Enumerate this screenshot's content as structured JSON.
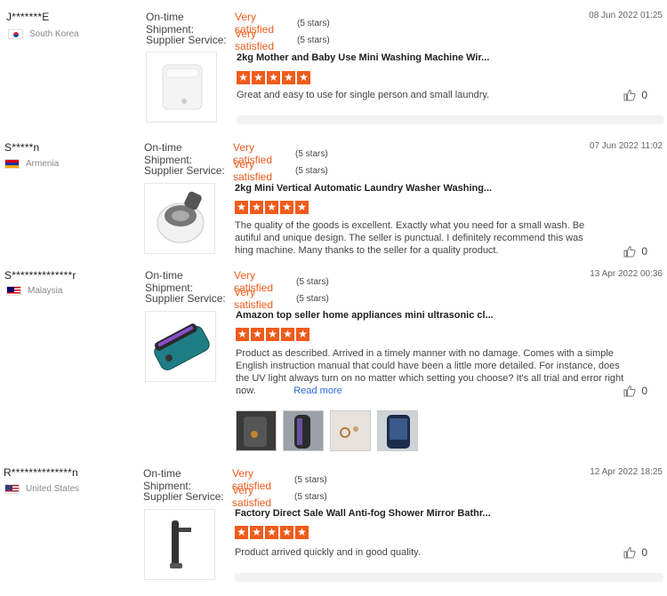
{
  "labels": {
    "ontime": "On-time Shipment:",
    "supplier": "Supplier Service:"
  },
  "colors": {
    "accent": "#f05b1b",
    "link": "#2a6ad8"
  },
  "reviews": [
    {
      "buyer": "J*******E",
      "country": "South Korea",
      "flag_icon": "south-korea-flag-icon",
      "date": "08 Jun 2022 01:25",
      "ontime_value": "Very satisfied",
      "ontime_stars": "(5 stars)",
      "supplier_value": "Very satisfied",
      "supplier_stars": "(5 stars)",
      "product_title": "2kg Mother and Baby Use Mini Washing Machine Wir...",
      "rating": 5,
      "text": "Great and easy to use for single person and small laundry.",
      "likes": "0"
    },
    {
      "buyer": "S*****n",
      "country": "Armenia",
      "flag_icon": "armenia-flag-icon",
      "date": "07 Jun 2022 11:02",
      "ontime_value": "Very satisfied",
      "ontime_stars": "(5 stars)",
      "supplier_value": "Very satisfied",
      "supplier_stars": "(5 stars)",
      "product_title": "2kg Mini Vertical Automatic Laundry Washer Washing...",
      "rating": 5,
      "text": "The quality of the goods is excellent.  Exactly what you need for a small wash.  Be autiful and unique design.  The seller is punctual.  I definitely recommend this was hing machine.  Many thanks to the seller for a quality product.",
      "likes": "0"
    },
    {
      "buyer": "S**************r",
      "country": "Malaysia",
      "flag_icon": "malaysia-flag-icon",
      "date": "13 Apr 2022 00:36",
      "ontime_value": "Very satisfied",
      "ontime_stars": "(5 stars)",
      "supplier_value": "Very satisfied",
      "supplier_stars": "(5 stars)",
      "product_title": "Amazon top seller home appliances mini ultrasonic cl...",
      "rating": 5,
      "text": "Product as described. Arrived in a timely manner with no damage. Comes with a simple English instruction manual that could have been a little more detailed. For instance, does the UV light always turn on no matter which setting you choose? It's all trial and error right now.",
      "ellipsis": "...",
      "read_more": "Read more",
      "likes": "0"
    },
    {
      "buyer": "R**************n",
      "country": "United States",
      "flag_icon": "united-states-flag-icon",
      "date": "12 Apr 2022 18:25",
      "ontime_value": "Very satisfied",
      "ontime_stars": "(5 stars)",
      "supplier_value": "Very satisfied",
      "supplier_stars": "(5 stars)",
      "product_title": "Factory Direct Sale Wall Anti-fog Shower Mirror Bathr...",
      "rating": 5,
      "text": "Product arrived quickly and in good quality.",
      "likes": "0"
    }
  ]
}
